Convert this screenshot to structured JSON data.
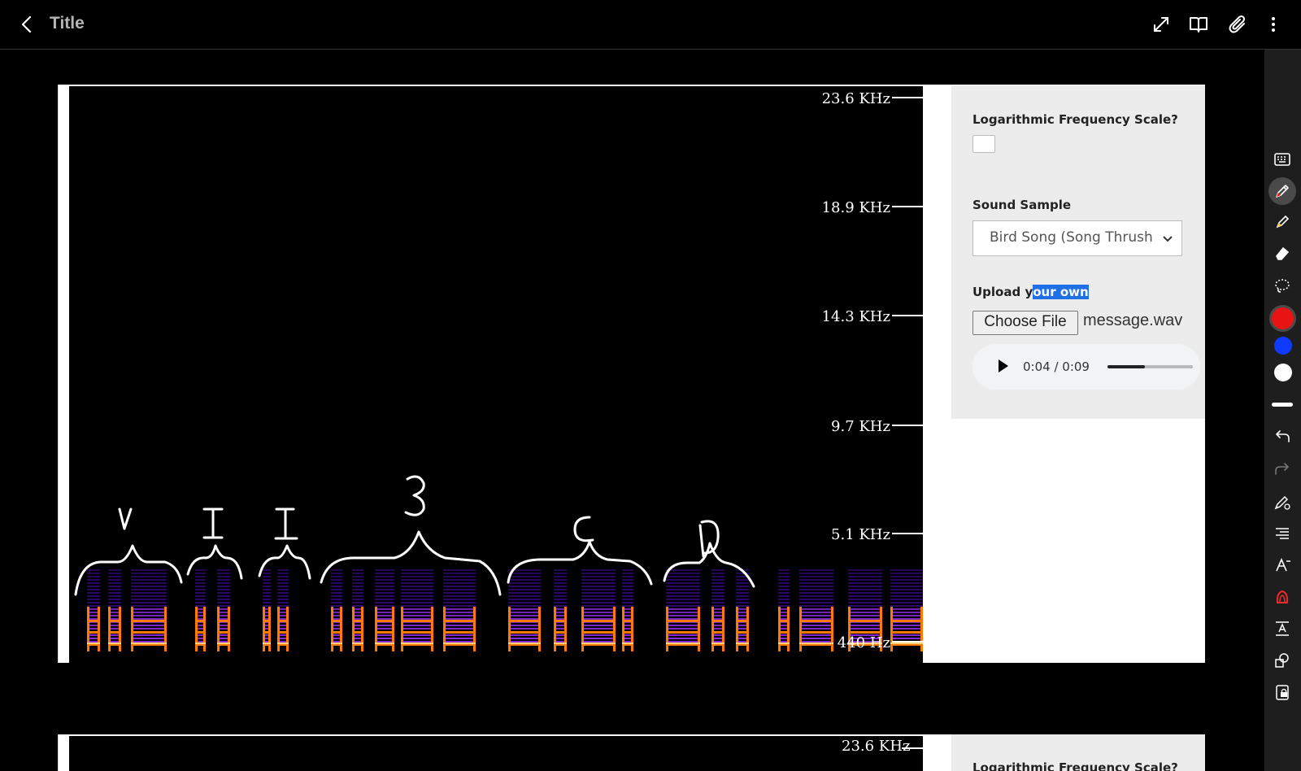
{
  "header": {
    "title": "Title",
    "icons": [
      "back-arrow-icon",
      "fullscreen-icon",
      "book-icon",
      "attachment-icon",
      "more-vertical-icon"
    ]
  },
  "toolbar": {
    "tools": [
      "keyboard-icon",
      "pen-icon",
      "highlighter-icon",
      "eraser-icon",
      "lasso-icon"
    ],
    "active_tool": "pen-icon",
    "colors": [
      "#e81313",
      "#0f3bff",
      "#ffffff"
    ],
    "active_color": "#e81313",
    "lower_tools": [
      "stroke-width-icon",
      "undo-icon",
      "redo-icon",
      "pen-settings-icon",
      "text-align-icon",
      "text-tool-icon",
      "shape-fill-icon",
      "text-size-icon",
      "shapes-icon",
      "lock-icon"
    ]
  },
  "spectrogram": {
    "frequency_labels": [
      "23.6  KHz",
      "18.9  KHz",
      "14.3  KHz",
      "9.7  KHz",
      "5.1  KHz",
      "440  Hz"
    ],
    "annotations": [
      "V",
      "I",
      "I",
      "3",
      "C",
      "D"
    ],
    "colors": {
      "low": "#3a0a8c",
      "mid": "#8a2be2",
      "high": "#ff7a00",
      "peak": "#ffd27a"
    }
  },
  "controls": {
    "log_scale_label": "Logarithmic Frequency Scale?",
    "log_scale_checked": false,
    "sound_sample_label": "Sound Sample",
    "sound_sample_value": "Bird Song (Song Thrush",
    "upload_label_prefix": "Upload y",
    "upload_label_selected": "our own",
    "choose_file_label": "Choose File",
    "file_name": "message.wav",
    "audio": {
      "current": "0:04",
      "duration": "0:09",
      "time_text": "0:04 / 0:09",
      "progress": 0.44
    }
  },
  "second_panel": {
    "top_frequency": "23.6  KHz",
    "log_scale_label": "Logarithmic Frequency Scale?"
  }
}
